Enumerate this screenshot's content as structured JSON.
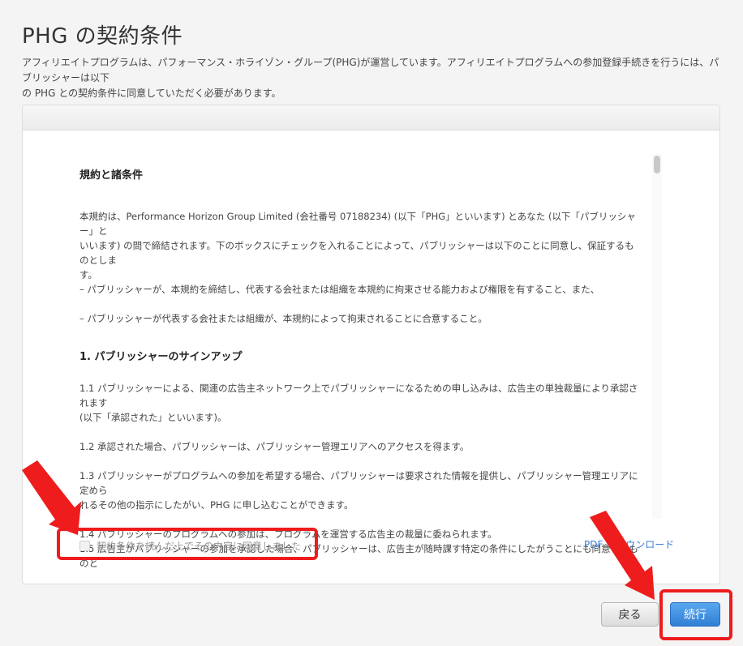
{
  "page": {
    "title": "PHG の契約条件",
    "intro_line1": "アフィリエイトプログラムは、パフォーマンス・ホライゾン・グループ(PHG)が運営しています。アフィリエイトプログラムへの参加登録手続きを行うには、パブリッシャーは以下",
    "intro_line2": "の PHG との契約条件に同意していただく必要があります。"
  },
  "terms": {
    "heading": "規約と諸条件",
    "para1_line1": "本規約は、Performance Horizon Group Limited (会社番号 07188234) (以下「PHG」といいます) とあなた (以下「パブリッシャー」と",
    "para1_line2": "いいます) の間で締結されます。下のボックスにチェックを入れることによって、パブリッシャーは以下のことに同意し、保証するものとしま",
    "para1_line3": "す。",
    "bullet1": "– パブリッシャーが、本規約を締結し、代表する会社または組織を本規約に拘束させる能力および権限を有すること、また、",
    "bullet2": "– パブリッシャーが代表する会社または組織が、本規約によって拘束されることに合意すること。",
    "section1_heading": "1. パブリッシャーのサインアップ",
    "s1_1_line1": "1.1 パブリッシャーによる、関連の広告主ネットワーク上でパブリッシャーになるための申し込みは、広告主の単独裁量により承認されます",
    "s1_1_line2": "(以下「承認された」といいます)。",
    "s1_2": "1.2 承認された場合、パブリッシャーは、パブリッシャー管理エリアへのアクセスを得ます。",
    "s1_3_line1": "1.3 パブリッシャーがプログラムへの参加を希望する場合、パブリッシャーは要求された情報を提供し、パブリッシャー管理エリアに定めら",
    "s1_3_line2": "れるその他の指示にしたがい、PHG に申し込むことができます。",
    "s1_4": "1.4 パブリッシャーのプログラムへの参加は、プログラムを運営する広告主の裁量に委ねられます。",
    "s1_5": "1.5 広告主がパブリッシャーの参加を承認した場合、パブリッシャーは、広告主が随時課す特定の条件にしたがうことにも同意するものと"
  },
  "agreement": {
    "checkbox_label": "契約条件を読んだ上でその内容に同意しました",
    "checked": false
  },
  "links": {
    "pdf_download": "PDF をダウンロード"
  },
  "buttons": {
    "back": "戻る",
    "continue": "続行"
  },
  "colors": {
    "highlight": "#ee1c1c",
    "primary_button": "#2f7fd6",
    "link": "#3a7bd5"
  }
}
